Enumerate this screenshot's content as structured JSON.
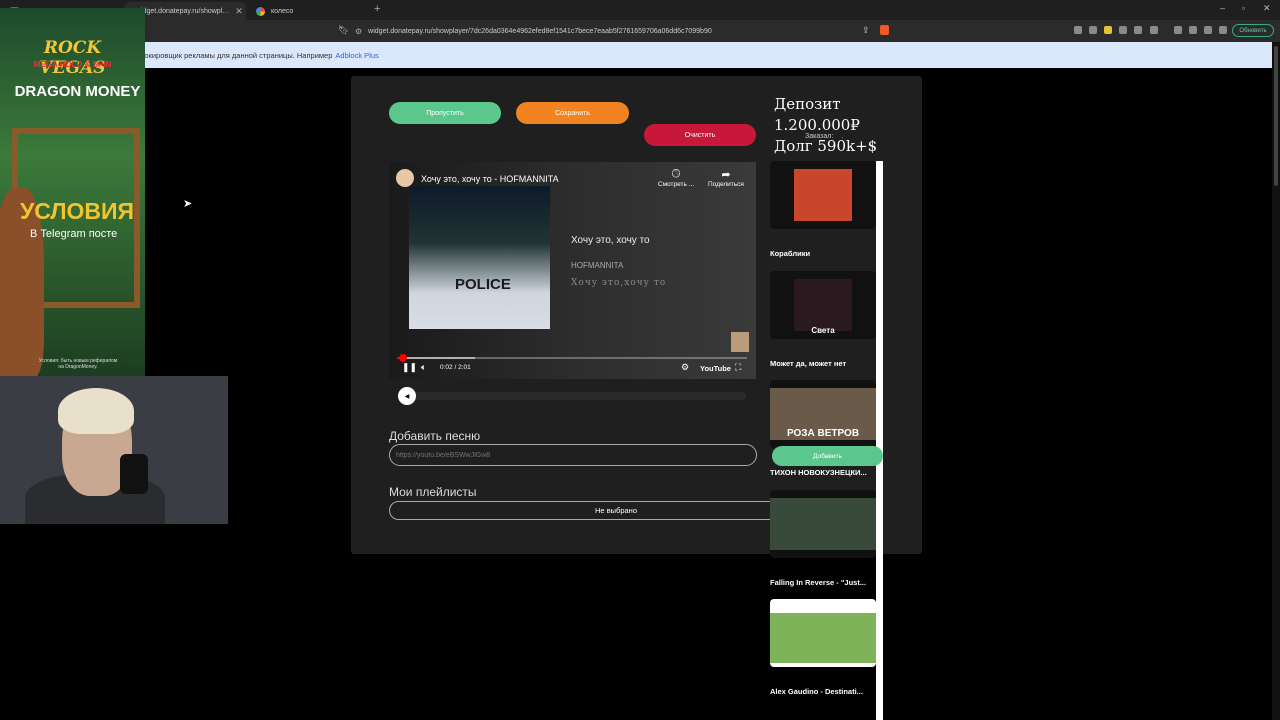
{
  "browser": {
    "tabs": [
      {
        "label": "widget.donatepay.ru/showpl…",
        "active": true
      },
      {
        "label": "колесо",
        "active": false
      }
    ],
    "url": "widget.donatepay.ru/showplayer/7dc26da0364e4962efed8ef1541c7bece7eaab5f2761659706a06dd6c7099b90",
    "update_label": "Обновить",
    "infobar_text": "блокировщик рекламы для данной страницы. Например",
    "infobar_link": "Adblock Plus"
  },
  "ad": {
    "brand1": "ROCK VEGAS",
    "brand1_sub": "MEGA HOLD & SPIN",
    "brand2": "DRAGON MONEY",
    "conditions": "УСЛОВИЯ",
    "telegram": "В Telegram посте",
    "fine_print": "Условия: быть новым рефералом на DragonMoney."
  },
  "widget": {
    "skip_label": "Пропустить",
    "save_label": "Сохранить",
    "clear_label": "Очистить",
    "deposit_line": "Депозит 1.200.000₽",
    "debt_line": "Долг  590k+$",
    "ordered_label": "Заказал:",
    "ordered_value": "."
  },
  "video": {
    "title": "Хочу это, хочу то - HOFMANNITA",
    "watch_later": "Смотреть ...",
    "share": "Поделиться",
    "overlay_title": "Хочу это, хочу то",
    "overlay_artist": "HOFMANNITA",
    "overlay_script": "Хочу это,хочу то",
    "thumbnail_text": "POLICE",
    "time": "0:02 / 2:01",
    "youtube_label": "YouTube",
    "progress": 0.0166
  },
  "add_song": {
    "heading": "Добавить песню",
    "placeholder": "https://youtu.be/eBSWwJlGw8"
  },
  "playlists": {
    "heading": "Мои плейлисты",
    "selected": "Не выбрано"
  },
  "queue": {
    "add_label": "Добавить",
    "items": [
      {
        "name": "Кораблики",
        "caption": "",
        "color": "#c9462c"
      },
      {
        "name": "Может да, может нет",
        "caption": "Света",
        "color": "#2a1a20"
      },
      {
        "name": "ТИХОН НОВОКУЗНЕЦКИ...",
        "caption": "РОЗА ВЕТРОВ",
        "color": "#6a5a4a"
      },
      {
        "name": "Falling In Reverse - \"Just...",
        "caption": "",
        "color": "#3a4a3a"
      },
      {
        "name": "Alex Gaudino - Destinati...",
        "caption": "",
        "color": "#7fb35a"
      }
    ]
  }
}
